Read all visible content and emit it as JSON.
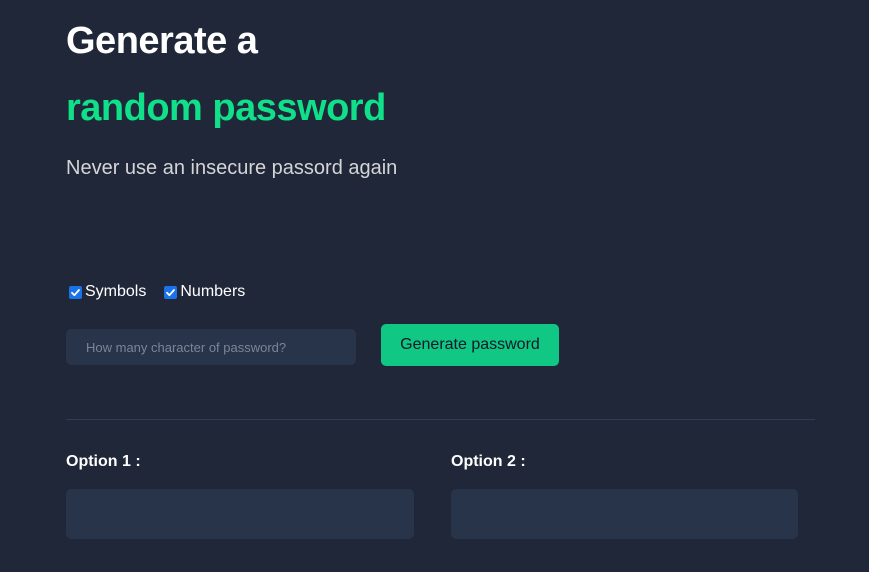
{
  "hero": {
    "title_line1": "Generate a",
    "title_line2": "random password",
    "subtitle": "Never use an insecure passord again"
  },
  "options": {
    "symbols": {
      "label": "Symbols",
      "checked": true
    },
    "numbers": {
      "label": "Numbers",
      "checked": true
    }
  },
  "length_input": {
    "placeholder": "How many character of password?",
    "value": ""
  },
  "generate_button": {
    "label": "Generate password"
  },
  "results": [
    {
      "label": "Option 1 :",
      "value": ""
    },
    {
      "label": "Option 2 :",
      "value": ""
    }
  ],
  "colors": {
    "background": "#1f2738",
    "accent": "#10e08a",
    "button": "#10c784",
    "field": "#273449",
    "checkbox": "#1a73e8"
  }
}
